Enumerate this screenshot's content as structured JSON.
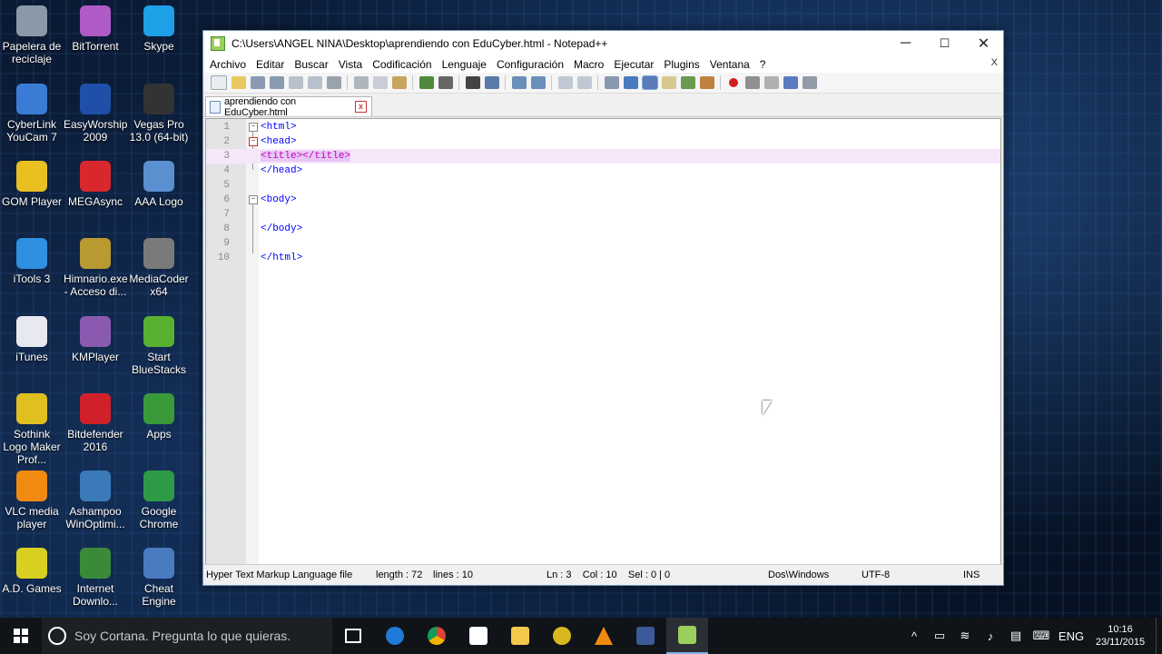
{
  "desktop": {
    "icons": [
      {
        "label": "Papelera de reciclaje",
        "icon": "recycle-bin-icon",
        "color": "#8a98a8"
      },
      {
        "label": "BitTorrent",
        "icon": "bittorrent-icon",
        "color": "#b05ac8"
      },
      {
        "label": "Skype",
        "icon": "skype-icon",
        "color": "#1da0e8"
      },
      {
        "label": "CyberLink YouCam 7",
        "icon": "youcam-icon",
        "color": "#3a7bd5"
      },
      {
        "label": "EasyWorship 2009",
        "icon": "easyworship-icon",
        "color": "#1f4fa8"
      },
      {
        "label": "Vegas Pro 13.0 (64-bit)",
        "icon": "vegas-icon",
        "color": "#333333"
      },
      {
        "label": "GOM Player",
        "icon": "gom-player-icon",
        "color": "#e8c020"
      },
      {
        "label": "MEGAsync",
        "icon": "megasync-icon",
        "color": "#d9272e"
      },
      {
        "label": "AAA Logo",
        "icon": "aaa-logo-icon",
        "color": "#5a8fd0"
      },
      {
        "label": "iTools 3",
        "icon": "itools-icon",
        "color": "#2f8fe0"
      },
      {
        "label": "Himnario.exe - Acceso di...",
        "icon": "himnario-icon",
        "color": "#b89a30"
      },
      {
        "label": "MediaCoder x64",
        "icon": "mediacoder-icon",
        "color": "#7a7a7a"
      },
      {
        "label": "iTunes",
        "icon": "itunes-icon",
        "color": "#e8e8f0"
      },
      {
        "label": "KMPlayer",
        "icon": "kmplayer-icon",
        "color": "#8a5ab0"
      },
      {
        "label": "Start BlueStacks",
        "icon": "bluestacks-icon",
        "color": "#5ab030"
      },
      {
        "label": "Sothink Logo Maker Prof...",
        "icon": "sothink-icon",
        "color": "#e0c020"
      },
      {
        "label": "Bitdefender 2016",
        "icon": "bitdefender-icon",
        "color": "#d0202a"
      },
      {
        "label": "Apps",
        "icon": "apps-icon",
        "color": "#3a9a3a"
      },
      {
        "label": "VLC media player",
        "icon": "vlc-icon",
        "color": "#f08a10"
      },
      {
        "label": "Ashampoo WinOptimi...",
        "icon": "ashampoo-icon",
        "color": "#3a7ab8"
      },
      {
        "label": "Google Chrome",
        "icon": "chrome-icon",
        "color": "#2f9a45"
      },
      {
        "label": "A.D. Games",
        "icon": "star-icon",
        "color": "#d8d020"
      },
      {
        "label": "Internet Downlo...",
        "icon": "idm-icon",
        "color": "#3a8a3a"
      },
      {
        "label": "Cheat Engine",
        "icon": "cheat-engine-icon",
        "color": "#4a7ac0"
      }
    ]
  },
  "window": {
    "title": "C:\\Users\\ANGEL NINA\\Desktop\\aprendiendo con EduCyber.html - Notepad++",
    "minimize": "─",
    "maximize": "☐",
    "close": "✕",
    "menu": [
      "Archivo",
      "Editar",
      "Buscar",
      "Vista",
      "Codificación",
      "Lenguaje",
      "Configuración",
      "Macro",
      "Ejecutar",
      "Plugins",
      "Ventana",
      "?"
    ],
    "menu_close": "X",
    "tab": {
      "name": "aprendiendo con EduCyber.html",
      "close": "x"
    },
    "lines": [
      {
        "num": "1",
        "text": "<html>"
      },
      {
        "num": "2",
        "text": "<head>"
      },
      {
        "num": "3",
        "text": "<title></title>"
      },
      {
        "num": "4",
        "text": "</head>"
      },
      {
        "num": "5",
        "text": ""
      },
      {
        "num": "6",
        "text": "<body>"
      },
      {
        "num": "7",
        "text": ""
      },
      {
        "num": "8",
        "text": "</body>"
      },
      {
        "num": "9",
        "text": ""
      },
      {
        "num": "10",
        "text": "</html>"
      }
    ],
    "status": {
      "language": "Hyper Text Markup Language file",
      "length": "length : 72",
      "lines": "lines : 10",
      "position": "Ln : 3    Col : 10    Sel : 0 | 0",
      "eol": "Dos\\Windows",
      "encoding": "UTF-8",
      "mode": "INS"
    }
  },
  "taskbar": {
    "search_placeholder": "Soy Cortana. Pregunta lo que quieras.",
    "language": "ENG",
    "time": "10:16",
    "date": "23/11/2015"
  }
}
